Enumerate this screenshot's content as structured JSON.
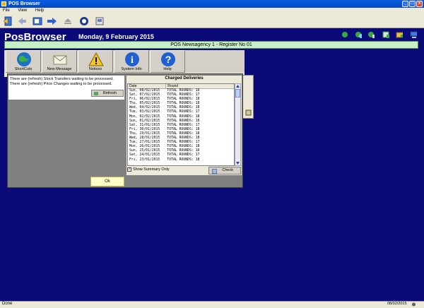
{
  "window": {
    "title": "POS Browser",
    "close": "x",
    "maximize": "□",
    "minimize": "_"
  },
  "menu": [
    "File",
    "View",
    "Help"
  ],
  "header": {
    "brand": "PosBrowser",
    "date": "Monday, 9 February 2015",
    "register": "POS Newsagency 1 - Register No 01"
  },
  "buttons": [
    {
      "label": "ShortCuts",
      "icon": "globe-icon"
    },
    {
      "label": "New Message",
      "icon": "envelope-icon"
    },
    {
      "label": "Notices",
      "icon": "warning-icon"
    },
    {
      "label": "System Info",
      "icon": "info-icon"
    },
    {
      "label": "Help",
      "icon": "help-icon"
    }
  ],
  "messages": {
    "line1": "There are (refresh) Stock Transfers waiting to be processed.",
    "line2": "There are (refresh) Price Changes waiting to be processed.",
    "refresh": "Refresh"
  },
  "deliveries": {
    "title": "Charged Deliveries",
    "columns": [
      "Date",
      "Round"
    ],
    "rows": [
      [
        "Sun, 08/02/2015",
        "TOTAL ROUNDS: 16"
      ],
      [
        "Sat, 07/02/2015",
        "TOTAL ROUNDS: 17"
      ],
      [
        "Fri, 06/02/2015",
        "TOTAL ROUNDS: 18"
      ],
      [
        "Thu, 05/02/2015",
        "TOTAL ROUNDS: 18"
      ],
      [
        "Wed, 04/02/2015",
        "TOTAL ROUNDS: 18"
      ],
      [
        "Tue, 03/02/2015",
        "TOTAL ROUNDS: 17"
      ],
      [
        "Mon, 02/02/2015",
        "TOTAL ROUNDS: 18"
      ],
      [
        "Sun, 01/02/2015",
        "TOTAL ROUNDS: 16"
      ],
      [
        "Sat, 31/01/2015",
        "TOTAL ROUNDS: 17"
      ],
      [
        "Fri, 30/01/2015",
        "TOTAL ROUNDS: 18"
      ],
      [
        "Thu, 29/01/2015",
        "TOTAL ROUNDS: 18"
      ],
      [
        "Wed, 28/01/2015",
        "TOTAL ROUNDS: 18"
      ],
      [
        "Tue, 27/01/2015",
        "TOTAL ROUNDS: 17"
      ],
      [
        "Mon, 26/01/2015",
        "TOTAL ROUNDS: 18"
      ],
      [
        "Sun, 25/01/2015",
        "TOTAL ROUNDS: 16"
      ],
      [
        "Sat, 24/01/2015",
        "TOTAL ROUNDS: 17"
      ],
      [
        "Fri, 23/01/2015",
        "TOTAL ROUNDS: 18"
      ]
    ],
    "summary_label": "Show Summary Only",
    "summary_checked": "✓",
    "check": "Check"
  },
  "ok": "Ok",
  "status": {
    "text": "Done",
    "date": "08/02/2015"
  },
  "colors": {
    "main_bg": "#0a0a78",
    "register_bar": "#c8f0c8",
    "ok_bg": "#fffdc8"
  }
}
